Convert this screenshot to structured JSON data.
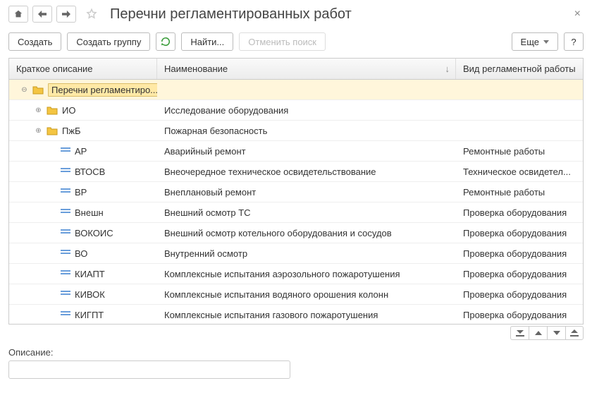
{
  "title": "Перечни регламентированных работ",
  "toolbar": {
    "create": "Создать",
    "create_group": "Создать группу",
    "find": "Найти...",
    "cancel_search": "Отменить поиск",
    "more": "Еще",
    "help": "?"
  },
  "columns": {
    "short": "Краткое описание",
    "name": "Наименование",
    "type": "Вид регламентной работы"
  },
  "rows": [
    {
      "level": 0,
      "kind": "folder",
      "expander": "minus",
      "short": "Перечни регламентиро...",
      "name": "",
      "type": "",
      "selected": true
    },
    {
      "level": 1,
      "kind": "folder",
      "expander": "plus",
      "short": "ИО",
      "name": "Исследование оборудования",
      "type": ""
    },
    {
      "level": 1,
      "kind": "folder",
      "expander": "plus",
      "short": "ПжБ",
      "name": "Пожарная безопасность",
      "type": ""
    },
    {
      "level": 2,
      "kind": "item",
      "short": "АР",
      "name": "Аварийный ремонт",
      "type": "Ремонтные работы"
    },
    {
      "level": 2,
      "kind": "item",
      "short": "ВТОСВ",
      "name": "Внеочередное техническое освидетельствование",
      "type": "Техническое освидетел..."
    },
    {
      "level": 2,
      "kind": "item",
      "short": "ВР",
      "name": "Внеплановый ремонт",
      "type": "Ремонтные работы"
    },
    {
      "level": 2,
      "kind": "item",
      "short": "Внешн",
      "name": "Внешний осмотр  ТС",
      "type": "Проверка оборудования"
    },
    {
      "level": 2,
      "kind": "item",
      "short": "ВОКОИС",
      "name": "Внешний осмотр котельного оборудования и сосудов",
      "type": "Проверка оборудования"
    },
    {
      "level": 2,
      "kind": "item",
      "short": "ВО",
      "name": "Внутренний осмотр",
      "type": "Проверка оборудования"
    },
    {
      "level": 2,
      "kind": "item",
      "short": "КИАПТ",
      "name": "Комплексные испытания аэрозольного пожаротушения",
      "type": "Проверка оборудования"
    },
    {
      "level": 2,
      "kind": "item",
      "short": "КИВОК",
      "name": "Комплексные испытания водяного орошения колонн",
      "type": "Проверка оборудования"
    },
    {
      "level": 2,
      "kind": "item",
      "short": "КИГПТ",
      "name": "Комплексные испытания газового пожаротушения",
      "type": "Проверка оборудования"
    }
  ],
  "description_label": "Описание:",
  "description_value": ""
}
